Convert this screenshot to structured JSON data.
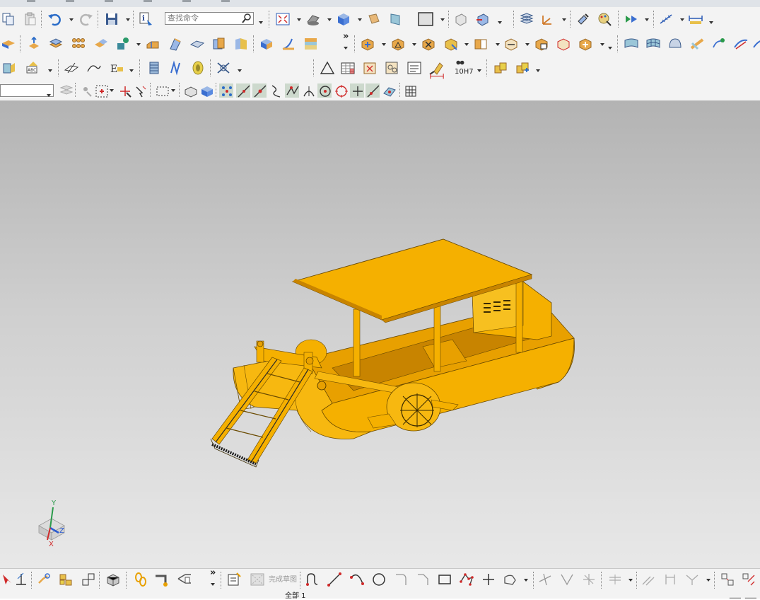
{
  "toolbar": {
    "search_placeholder": "查找命令",
    "overflow_chevron": "»",
    "fit_tolerance_label": "10H7",
    "finish_sketch_label": "完成草图"
  },
  "status": {
    "part_name": "全部 1"
  },
  "triad": {
    "x_label": "X",
    "y_label": "Y",
    "z_label": "Z"
  },
  "colors": {
    "model_fill": "#f5b000",
    "model_dark": "#d08a00",
    "model_shadow": "#b87400",
    "viewport_top": "#b3b3b3",
    "viewport_bottom": "#e8e8e8",
    "toolbar_bg": "#f3f3f3"
  },
  "icons": [
    "copy-icon",
    "paste-icon",
    "undo-icon",
    "redo-icon",
    "save-icon",
    "info-icon",
    "search-icon",
    "fit-view-icon",
    "shade-icon",
    "cube-icon",
    "sketch-plane-icon",
    "extrude-icon",
    "revolve-icon",
    "hole-icon",
    "blend-icon",
    "chamfer-icon",
    "shell-icon",
    "pattern-icon",
    "assembly-icon",
    "measure-icon",
    "spring-icon",
    "gear-icon",
    "triangle-icon",
    "table-icon",
    "binocular-icon",
    "line-icon",
    "arc-icon",
    "circle-icon",
    "rectangle-icon",
    "point-icon",
    "plus-icon",
    "trim-icon"
  ]
}
